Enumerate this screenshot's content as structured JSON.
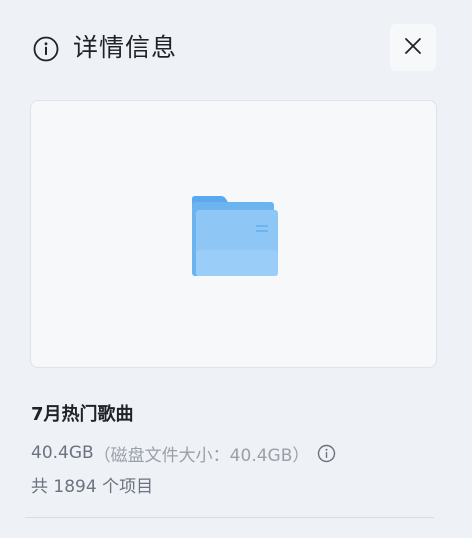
{
  "header": {
    "title": "详情信息",
    "info_icon": "info-circle-icon",
    "close_icon": "close-icon"
  },
  "preview": {
    "icon": "folder-icon",
    "folder_color": "#6cb4f0"
  },
  "details": {
    "name": "7月热门歌曲",
    "size": "40.4GB",
    "size_detail": "（磁盘文件大小：40.4GB）",
    "size_info_icon": "info-circle-icon",
    "item_count": "共 1894 个项目"
  }
}
